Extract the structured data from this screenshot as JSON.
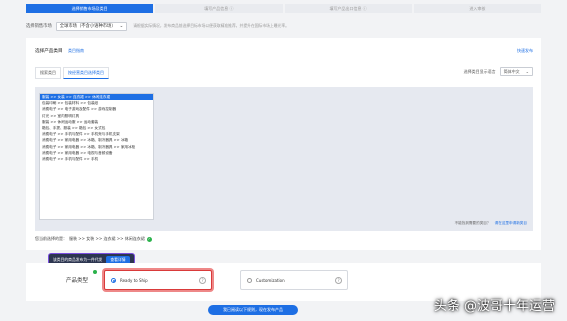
{
  "steps": [
    {
      "label": "选择销售市场及类目",
      "active": true
    },
    {
      "label": "填写产品信息 ⓘ",
      "active": false
    },
    {
      "label": "填写产品出口信息 ⓘ",
      "active": false
    },
    {
      "label": "进入审核",
      "active": false
    }
  ],
  "market": {
    "label": "选择销售市场",
    "value": "全球市场（不含小语种市场）",
    "hint": "请根据实际情况，发布商品前选择目标市场以便获取精准推荐，并提升在国际市场上曝光率。"
  },
  "category_card": {
    "title": "选择产品类目",
    "help_link": "类目指南",
    "quick_publish": "快速发布",
    "tabs": [
      {
        "label": "搜索类目",
        "active": false
      },
      {
        "label": "按经营类目选择类目",
        "active": true
      }
    ],
    "lang_label": "选择类目显示语言",
    "lang_value": "简体中文",
    "categories": [
      {
        "label": "服装 >> 女装 >> 连衣裙 >> 休闲连衣裙",
        "selected": true
      },
      {
        "label": "包装印刷 >> 包装材料 >> 包装纸",
        "selected": false
      },
      {
        "label": "消费电子 >> 电子游戏及配件 >> 游戏控制器",
        "selected": false
      },
      {
        "label": "灯光 >> 室内照明灯具",
        "selected": false
      },
      {
        "label": "服装 >> 休闲运动服 >> 运动套装",
        "selected": false
      },
      {
        "label": "箱包、手提、服装 >> 箱包 >> 女式包",
        "selected": false
      },
      {
        "label": "消费电子 >> 手机与配件 >> 手机壳与手机支架",
        "selected": false
      },
      {
        "label": "消费电子 >> 家用电器 >> 冰箱、制冷器具 >> 冰箱",
        "selected": false
      },
      {
        "label": "消费电子 >> 家用电器 >> 冰箱、制冷器具 >> 家用冰柜",
        "selected": false
      },
      {
        "label": "消费电子 >> 家用电器 >> 电视与音频设备",
        "selected": false
      },
      {
        "label": "消费电子 >> 手机与配件 >> 手机",
        "selected": false
      }
    ],
    "not_found_text": "不能找到需要的类目？",
    "not_found_link": "请在这里申请新类目",
    "selected_label": "您当前选择的是：",
    "selected_value": "服装 >> 女装 >> 连衣裙 >> 休闲连衣裙"
  },
  "tooltip": {
    "text": "该类目的商品发布为一件代发",
    "button": "查看详情"
  },
  "product_type": {
    "label": "产品类型",
    "options": [
      {
        "label": "Ready to Ship",
        "selected": true
      },
      {
        "label": "Customization",
        "selected": false
      }
    ]
  },
  "next_button": "我已阅读以下规则，现在发布产品",
  "watermark": "头条 @波哥十年运营"
}
